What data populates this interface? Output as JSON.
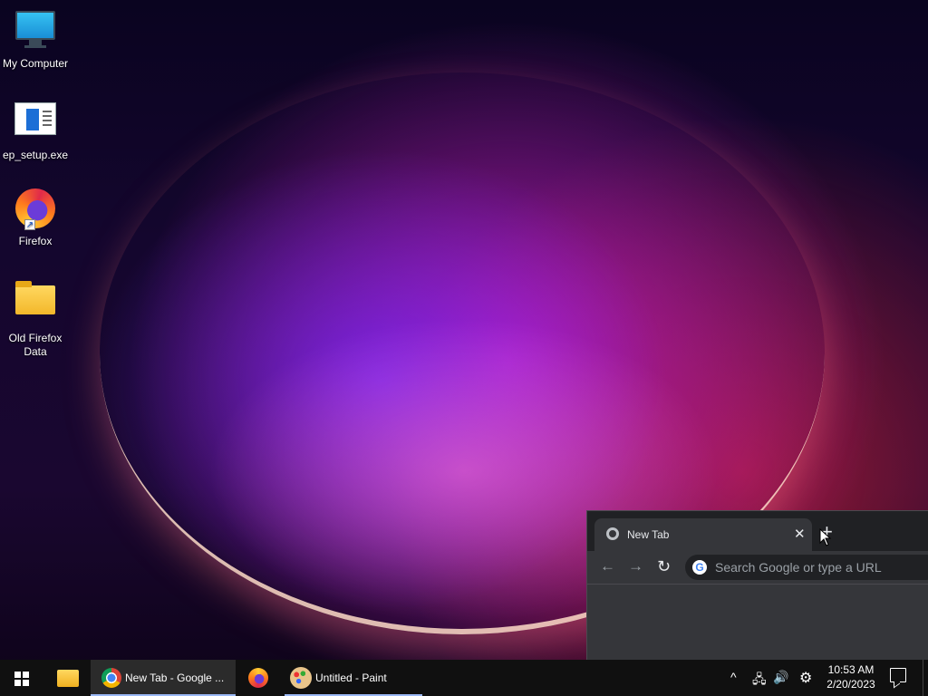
{
  "desktop": {
    "icons": [
      {
        "label": "My Computer",
        "icon": "computer-icon"
      },
      {
        "label": "ep_setup.exe",
        "icon": "setup-exe-icon"
      },
      {
        "label": "Firefox",
        "icon": "firefox-icon"
      },
      {
        "label": "Old Firefox Data",
        "icon": "folder-icon"
      }
    ]
  },
  "chrome": {
    "tab_title": "New Tab",
    "tab_close": "✕",
    "new_tab": "+",
    "back": "←",
    "forward": "→",
    "reload": "↻",
    "omnibox_icon": "G",
    "omnibox_placeholder": "Search Google or type a URL"
  },
  "taskbar": {
    "chrome_label": "New Tab - Google ...",
    "paint_label": "Untitled - Paint",
    "tray_chevron": "^",
    "network": "🖧",
    "volume": "🔊",
    "settings": "⚙",
    "time": "10:53 AM",
    "date": "2/20/2023"
  },
  "colors": {
    "taskbar_bg": "#101010",
    "chrome_frame": "#202124",
    "chrome_toolbar": "#35363a",
    "active_indicator": "#9ab8f5"
  }
}
